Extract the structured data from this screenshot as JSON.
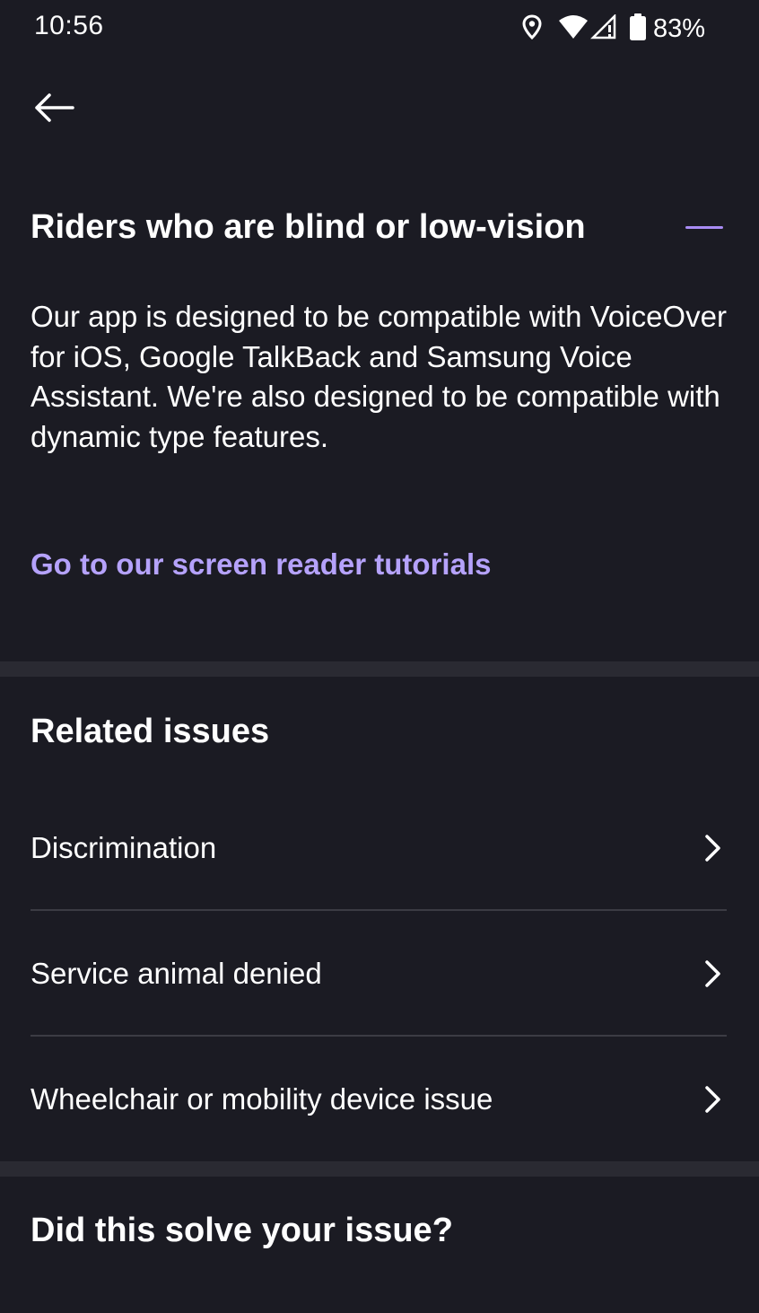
{
  "status_bar": {
    "time": "10:56",
    "battery_percent": "83%",
    "icons": [
      "location-icon",
      "wifi-icon",
      "signal-icon",
      "battery-icon"
    ]
  },
  "nav": {
    "back_icon": "arrow-left-icon"
  },
  "accordion": {
    "title": "Riders who are blind or low-vision",
    "expanded": true,
    "collapse_icon": "minus-icon",
    "body": "Our app is designed to be compatible with VoiceOver for iOS, Google TalkBack and Samsung Voice Assistant. We're also designed to be compatible with dynamic type features.",
    "link_label": "Go to our screen reader tutorials"
  },
  "related_issues": {
    "title": "Related issues",
    "items": [
      {
        "label": "Discrimination"
      },
      {
        "label": "Service animal denied"
      },
      {
        "label": "Wheelchair or mobility device issue"
      }
    ]
  },
  "feedback": {
    "title": "Did this solve your issue?"
  },
  "colors": {
    "background": "#1b1b23",
    "accent": "#a98cf4",
    "link": "#b5a2fb",
    "divider": "#2a2a32"
  }
}
